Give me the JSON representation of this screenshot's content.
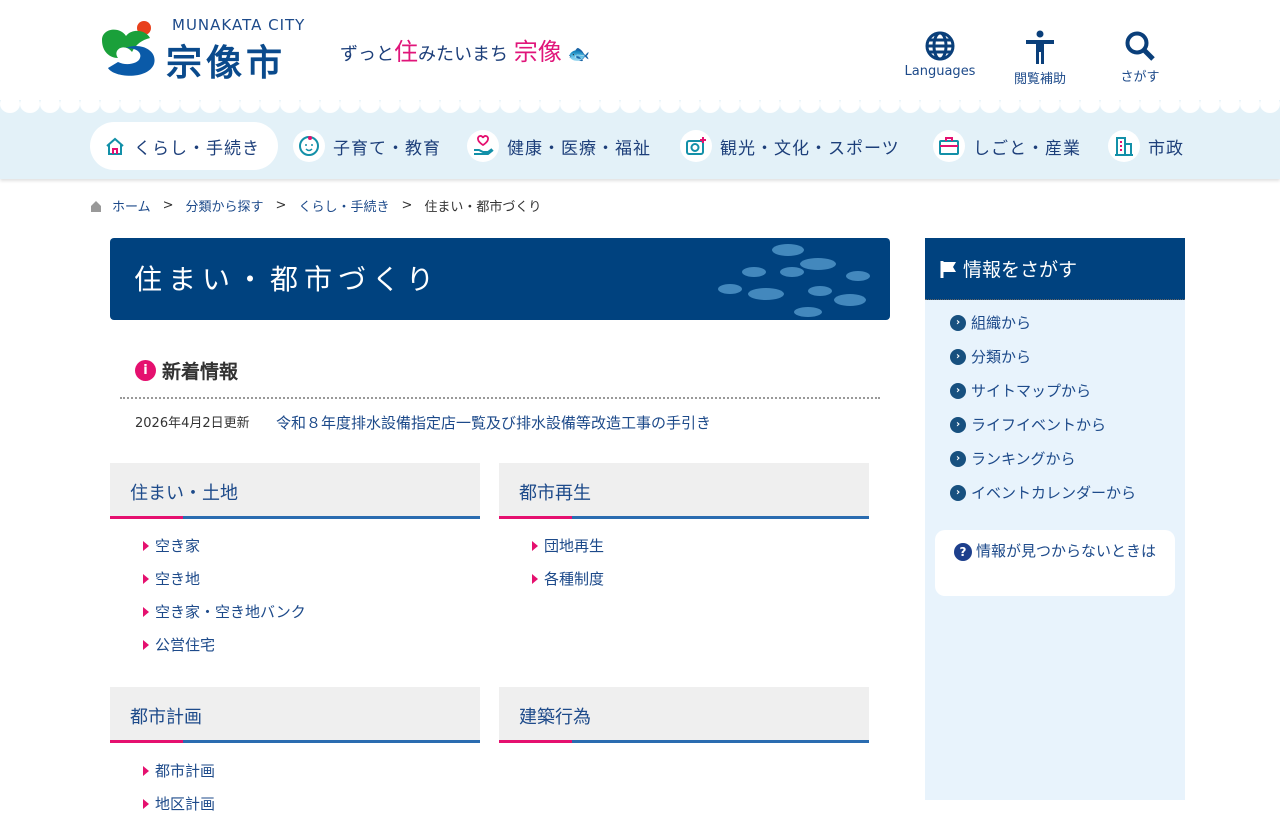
{
  "header": {
    "logo_en": "MUNAKATA CITY",
    "logo_jp": "宗像市",
    "slogan_a": "ずっと",
    "slogan_b": "住",
    "slogan_c": "みたいまち",
    "slogan_d": "宗像",
    "tools": [
      {
        "label": "Languages",
        "icon": "globe-icon"
      },
      {
        "label": "閲覧補助",
        "icon": "accessibility-icon"
      },
      {
        "label": "さがす",
        "icon": "search-icon"
      }
    ]
  },
  "nav": [
    {
      "label": "くらし・手続き"
    },
    {
      "label": "子育て・教育"
    },
    {
      "label": "健康・医療・福祉"
    },
    {
      "label": "観光・文化・スポーツ"
    },
    {
      "label": "しごと・産業"
    },
    {
      "label": "市政"
    }
  ],
  "breadcrumb": [
    "ホーム",
    "分類から探す",
    "くらし・手続き",
    "住まい・都市づくり"
  ],
  "page_title": "住まい・都市づくり",
  "news": {
    "heading": "新着情報",
    "date": "2026年4月2日更新",
    "link": "令和８年度排水設備指定店一覧及び排水設備等改造工事の手引き"
  },
  "sections": [
    {
      "title": "住まい・土地",
      "items": [
        "空き家",
        "空き地",
        "空き家・空き地バンク",
        "公営住宅"
      ]
    },
    {
      "title": "都市再生",
      "items": [
        "団地再生",
        "各種制度"
      ]
    },
    {
      "title": "都市計画",
      "items": [
        "都市計画",
        "地区計画"
      ]
    },
    {
      "title": "建築行為",
      "items": []
    }
  ],
  "sidebar": {
    "title": "情報をさがす",
    "items": [
      "組織から",
      "分類から",
      "サイトマップから",
      "ライフイベントから",
      "ランキングから",
      "イベントカレンダーから"
    ],
    "notfound": "情報が見つからないときは"
  },
  "colors": {
    "navy": "#00427f",
    "pink": "#e5106f",
    "sidebar_bg": "#e8f3fc"
  }
}
